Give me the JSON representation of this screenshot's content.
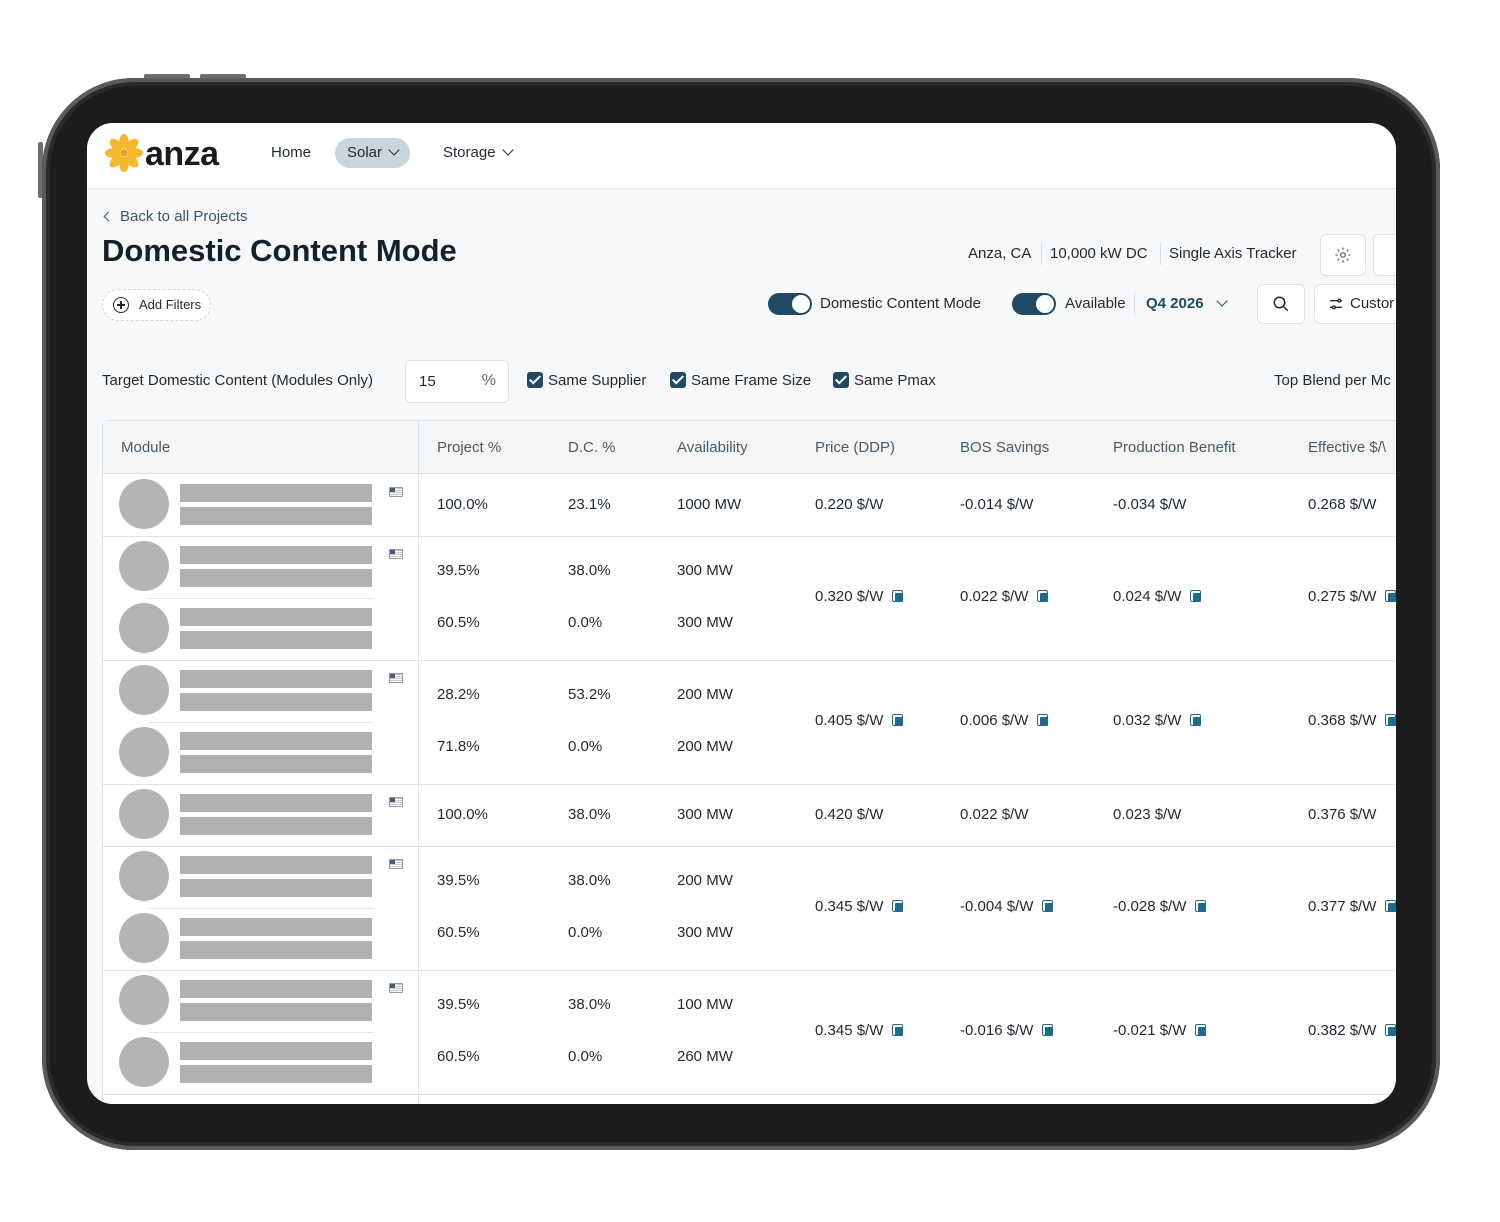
{
  "nav": {
    "logo_text": "anza",
    "home": "Home",
    "solar": "Solar",
    "storage": "Storage"
  },
  "header": {
    "back_link": "Back to all Projects",
    "title": "Domestic Content Mode",
    "location": "Anza, CA",
    "capacity": "10,000 kW DC",
    "tracker": "Single Axis Tracker"
  },
  "controls": {
    "add_filters": "Add Filters",
    "domestic_toggle_label": "Domestic Content Mode",
    "available_toggle_label": "Available",
    "quarter": "Q4 2026",
    "customize": "Custor"
  },
  "filters": {
    "target_label": "Target Domestic Content (Modules Only)",
    "target_value": "15",
    "target_unit": "%",
    "same_supplier": "Same Supplier",
    "same_frame_size": "Same Frame Size",
    "same_pmax": "Same Pmax",
    "top_blend": "Top Blend per Mc"
  },
  "table": {
    "columns": [
      "Module",
      "Project %",
      "D.C. %",
      "Availability",
      "Price (DDP)",
      "BOS Savings",
      "Production Benefit",
      "Effective $/\\"
    ],
    "rows": [
      {
        "project": [
          "100.0%"
        ],
        "dc": [
          "23.1%"
        ],
        "availability": [
          "1000 MW"
        ],
        "price": "0.220 $/W",
        "bos": "-0.014 $/W",
        "production": "-0.034 $/W",
        "effective": "0.268 $/W"
      },
      {
        "project": [
          "39.5%",
          "60.5%"
        ],
        "dc": [
          "38.0%",
          "0.0%"
        ],
        "availability": [
          "300 MW",
          "300 MW"
        ],
        "price": "0.320 $/W",
        "bos": "0.022 $/W",
        "production": "0.024 $/W",
        "effective": "0.275 $/W"
      },
      {
        "project": [
          "28.2%",
          "71.8%"
        ],
        "dc": [
          "53.2%",
          "0.0%"
        ],
        "availability": [
          "200 MW",
          "200 MW"
        ],
        "price": "0.405 $/W",
        "bos": "0.006 $/W",
        "production": "0.032 $/W",
        "effective": "0.368 $/W"
      },
      {
        "project": [
          "100.0%"
        ],
        "dc": [
          "38.0%"
        ],
        "availability": [
          "300 MW"
        ],
        "price": "0.420 $/W",
        "bos": "0.022 $/W",
        "production": "0.023 $/W",
        "effective": "0.376 $/W"
      },
      {
        "project": [
          "39.5%",
          "60.5%"
        ],
        "dc": [
          "38.0%",
          "0.0%"
        ],
        "availability": [
          "200 MW",
          "300 MW"
        ],
        "price": "0.345 $/W",
        "bos": "-0.004 $/W",
        "production": "-0.028 $/W",
        "effective": "0.377 $/W"
      },
      {
        "project": [
          "39.5%",
          "60.5%"
        ],
        "dc": [
          "38.0%",
          "0.0%"
        ],
        "availability": [
          "100 MW",
          "260 MW"
        ],
        "price": "0.345 $/W",
        "bos": "-0.016 $/W",
        "production": "-0.021 $/W",
        "effective": "0.382 $/W"
      }
    ]
  },
  "colors": {
    "accent": "#1e4a63",
    "logo_yellow": "#f5b82e",
    "active_nav": "#c9d6e0"
  }
}
